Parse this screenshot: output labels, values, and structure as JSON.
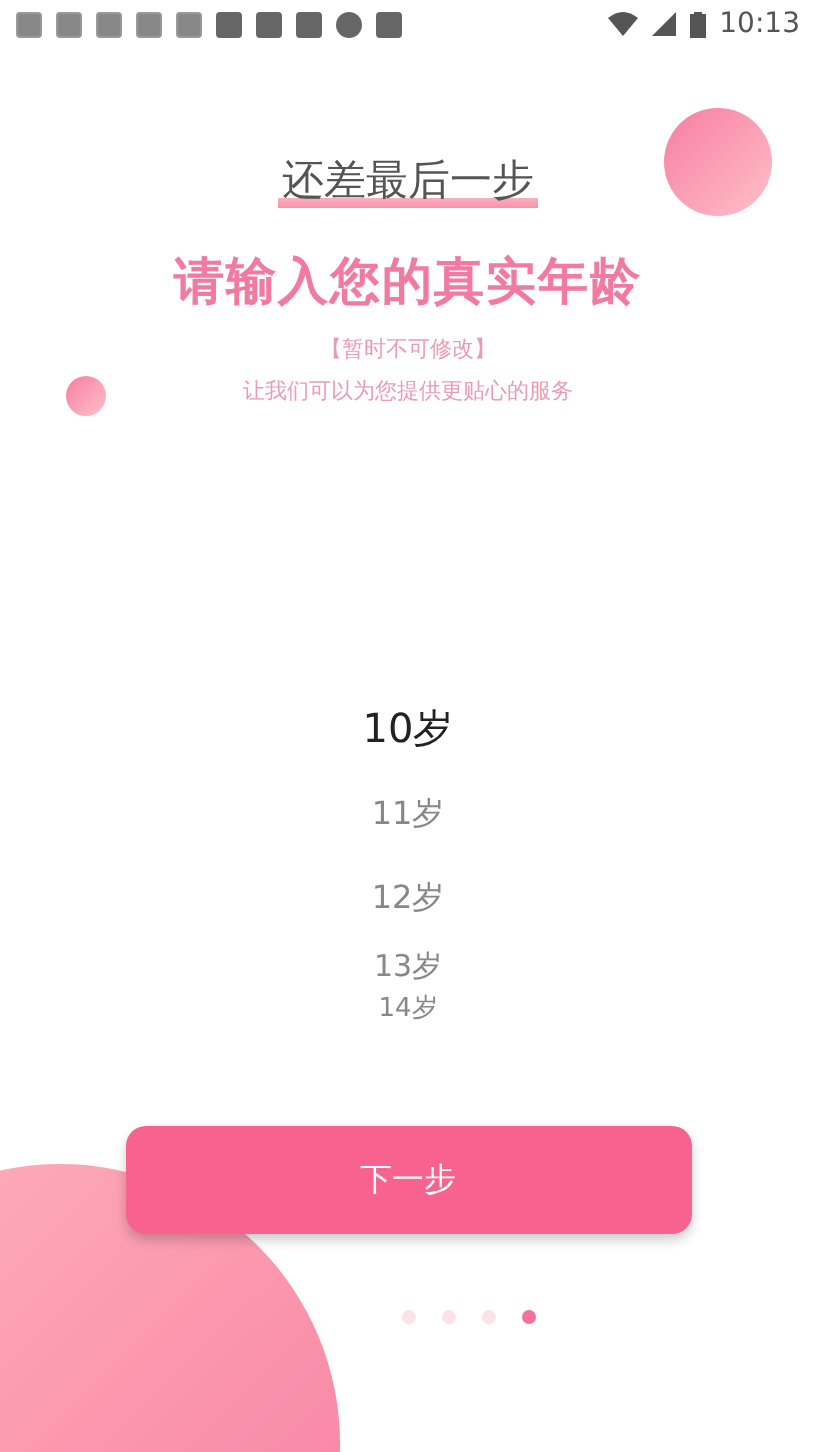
{
  "status_bar": {
    "time": "10:13"
  },
  "heading": "还差最后一步",
  "title": "请输入您的真实年龄",
  "note": "【暂时不可修改】",
  "subtitle": "让我们可以为您提供更贴心的服务",
  "age_picker": [
    {
      "label": "10岁",
      "selected": true
    },
    {
      "label": "11岁",
      "selected": false
    },
    {
      "label": "12岁",
      "selected": false
    },
    {
      "label": "13岁",
      "selected": false
    },
    {
      "label": "14岁",
      "selected": false
    }
  ],
  "next_button": "下一步",
  "page_dots": [
    {
      "selected": false
    },
    {
      "selected": false
    },
    {
      "selected": false
    },
    {
      "selected": true
    }
  ]
}
